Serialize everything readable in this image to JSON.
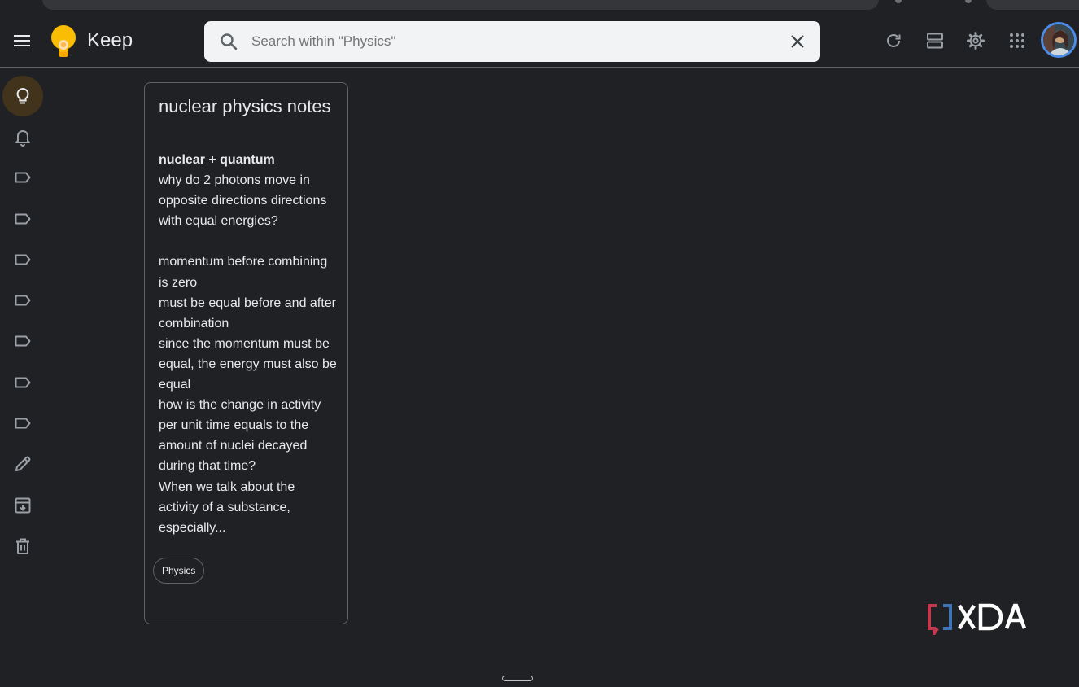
{
  "app": {
    "title": "Keep"
  },
  "search": {
    "placeholder": "Search within \"Physics\"",
    "value": ""
  },
  "header_icons": [
    "refresh-icon",
    "list-view-icon",
    "settings-icon",
    "apps-grid-icon"
  ],
  "sidebar": {
    "items": [
      {
        "icon": "lightbulb-icon",
        "active": true
      },
      {
        "icon": "bell-icon"
      },
      {
        "icon": "label-icon"
      },
      {
        "icon": "label-icon"
      },
      {
        "icon": "label-icon"
      },
      {
        "icon": "label-icon"
      },
      {
        "icon": "label-icon"
      },
      {
        "icon": "label-icon"
      },
      {
        "icon": "label-icon"
      },
      {
        "icon": "pencil-icon"
      },
      {
        "icon": "archive-icon"
      },
      {
        "icon": "trash-icon"
      }
    ]
  },
  "note": {
    "title": "nuclear physics notes",
    "heading": "nuclear + quantum",
    "lines": [
      "why do 2 photons move in",
      "opposite directions directions",
      "with equal energies?",
      "",
      "momentum before combining",
      "is zero",
      "must be equal before and after",
      "combination",
      "since the momentum must be",
      "equal, the energy must also be",
      "equal",
      "how is the change in activity",
      "per unit time equals to the",
      "amount of nuclei decayed",
      "during that time?",
      "When we talk about the",
      "activity of a substance,",
      "especially..."
    ],
    "label": "Physics"
  },
  "watermark": {
    "text": "XDA",
    "colors": {
      "bracket_red": "#c2384e",
      "bracket_blue": "#3d74b8",
      "letters": "#ffffff"
    }
  },
  "colors": {
    "background": "#202124",
    "text": "#e8eaed",
    "border": "#5f6368",
    "active_bg": "#41331c",
    "accent_yellow": "#fbbc04"
  }
}
